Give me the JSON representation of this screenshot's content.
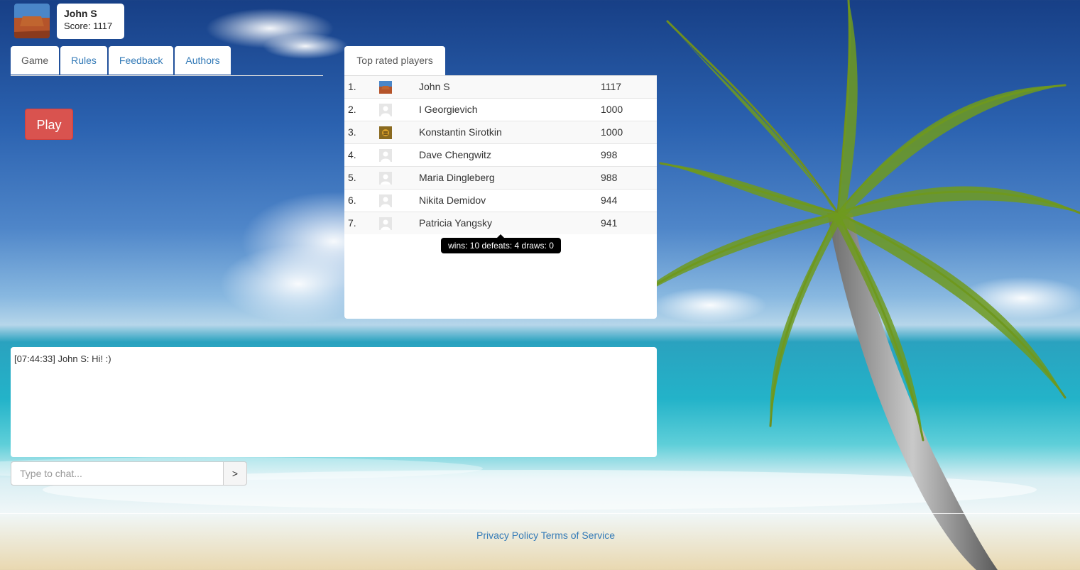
{
  "user": {
    "name": "John S",
    "score_text": "Score: 1117"
  },
  "tabs": [
    {
      "label": "Game"
    },
    {
      "label": "Rules"
    },
    {
      "label": "Feedback"
    },
    {
      "label": "Authors"
    }
  ],
  "play_label": "Play",
  "top_players": {
    "tab_label": "Top rated players",
    "rows": [
      {
        "rank": "1.",
        "name": "John S",
        "score": "1117",
        "avatar": "desert-photo"
      },
      {
        "rank": "2.",
        "name": "I Georgievich",
        "score": "1000",
        "avatar": "default-user-icon"
      },
      {
        "rank": "3.",
        "name": "Konstantin Sirotkin",
        "score": "1000",
        "avatar": "tiger-photo"
      },
      {
        "rank": "4.",
        "name": "Dave Chengwitz",
        "score": "998",
        "avatar": "default-user-icon"
      },
      {
        "rank": "5.",
        "name": "Maria Dingleberg",
        "score": "988",
        "avatar": "default-user-icon"
      },
      {
        "rank": "6.",
        "name": "Nikita Demidov",
        "score": "944",
        "avatar": "default-user-icon"
      },
      {
        "rank": "7.",
        "name": "Patricia Yangsky",
        "score": "941",
        "avatar": "default-user-icon"
      }
    ],
    "tooltip": "wins: 10 defeats: 4 draws: 0"
  },
  "chat": {
    "messages": [
      {
        "text": "[07:44:33] John S: Hi! :)"
      }
    ],
    "placeholder": "Type to chat...",
    "send_label": ">"
  },
  "footer": {
    "privacy": "Privacy Policy",
    "terms": "Terms of Service"
  }
}
